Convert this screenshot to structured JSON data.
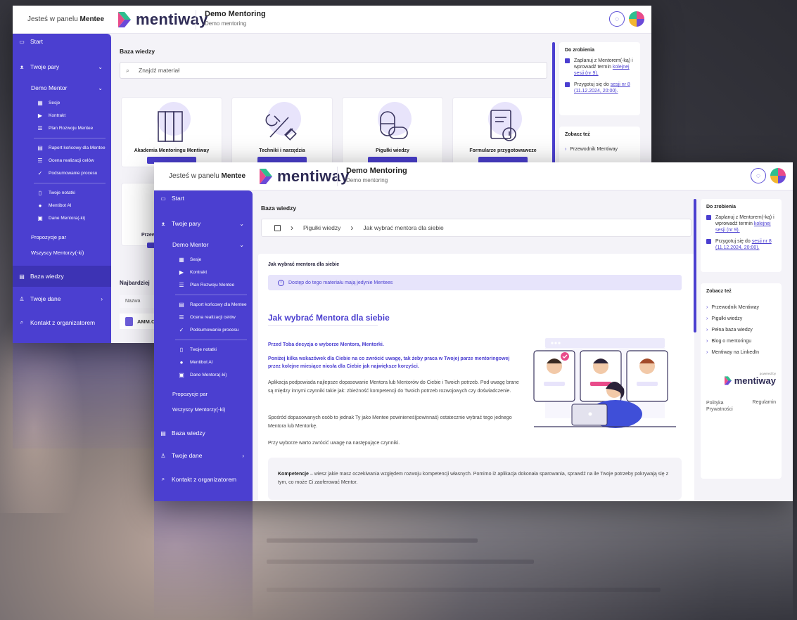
{
  "topbar": {
    "who_prefix": "Jesteś w panelu",
    "who_role": "Mentee",
    "brand": "mentiway",
    "program_title": "Demo Mentoring",
    "program_subtitle": "Demo mentoring"
  },
  "sidebar": {
    "start": "Start",
    "pairs": "Twoje pary",
    "demo_mentor": "Demo Mentor",
    "sub": [
      "Sesje",
      "Kontrakt",
      "Plan Rozwoju Mentee",
      "Raport końcowy dla Mentee",
      "Ocena realizacji celów",
      "Podsumowanie procesu",
      "Twoje notatki",
      "Mentibot AI",
      "Dane Mentora(-ki)"
    ],
    "proposals": "Propozycje par",
    "all_mentors": "Wszyscy Mentorzy(-ki)",
    "knowledge": "Baza wiedzy",
    "your_data": "Twoje dane",
    "contact": "Kontakt z organizatorem"
  },
  "window1": {
    "section": "Baza wiedzy",
    "search_placeholder": "Znajdź materiał",
    "cards": [
      "Akademia Mentoringu Mentiway",
      "Techniki i narzędzia",
      "Pigułki wiedzy",
      "Formularze przygotowawcze"
    ],
    "partial_card": "Przew",
    "recent": "Najbardziej",
    "table_header": "Nazwa",
    "row_file": "AMM.C"
  },
  "window2": {
    "section": "Baza wiedzy",
    "breadcrumb": [
      "Pigułki wiedzy",
      "Jak wybrać mentora dla siebie"
    ],
    "article_title": "Jak wybrać mentora dla siebie",
    "notice": "Dostęp do tego materiału mają jedynie Mentees",
    "heading": "Jak wybrać Mentora dla siebie",
    "lead1": "Przed Toba decyzja o wyborze Mentora, Mentorki.",
    "lead2": "Poniżej kilka wskazówek dla Ciebie na co zwrócić uwagę, tak żeby praca w Twojej parze mentoringowej przez kolejne miesiące niosła dla Ciebie jak największe korzyści.",
    "para1": "Aplikacja podpowiada najlepsze dopasowanie Mentora lub Mentorów do Ciebie i Twoich potrzeb. Pod uwagę brane są między innymi czynniki takie jak: zbieżność kompetencji do Twoich potrzeb rozwojowych czy doświadczenie.",
    "para2": "Spośród dopasowanych osób to jednak Ty jako Mentee powinieneś(powinnaś) ostatecznie wybrać tego jednego Mentora lub Mentorkę.",
    "para3": "Przy wyborze warto zwrócić uwagę na następujące czynniki.",
    "box_bold": "Kompetencje",
    "box_text": " – wiesz jakie masz oczekiwania względem rozwoju kompetencji własnych. Pomimo iż aplikacja dokonała sparowania, sprawdź na ile Twoje potrzeby pokrywają się z tym, co może Ci zaoferować Mentor."
  },
  "rightpanel": {
    "todo_title": "Do zrobienia",
    "todo1_text": "Zaplanuj z Mentorem(-ką) i wprowadź termin",
    "todo1_link": "kolejnej sesji (nr 9).",
    "todo2_text": "Przygotuj się do",
    "todo2_link": "sesji nr 8 (11.12.2024, 20:00).",
    "see_title": "Zobacz też",
    "see": [
      "Przewodnik Mentiway",
      "Pigułki wiedzy",
      "Pełna baza wiedzy",
      "Blog o mentoringu",
      "Mentiway na LinkedIn"
    ],
    "powered": "powered by",
    "footer": [
      "Polityka Prywatności",
      "Regulamin"
    ]
  },
  "colors": {
    "primary": "#4b3fd0",
    "accent_chevron": [
      "#2fbf8f",
      "#e94b8a",
      "#6b4ad8"
    ]
  }
}
